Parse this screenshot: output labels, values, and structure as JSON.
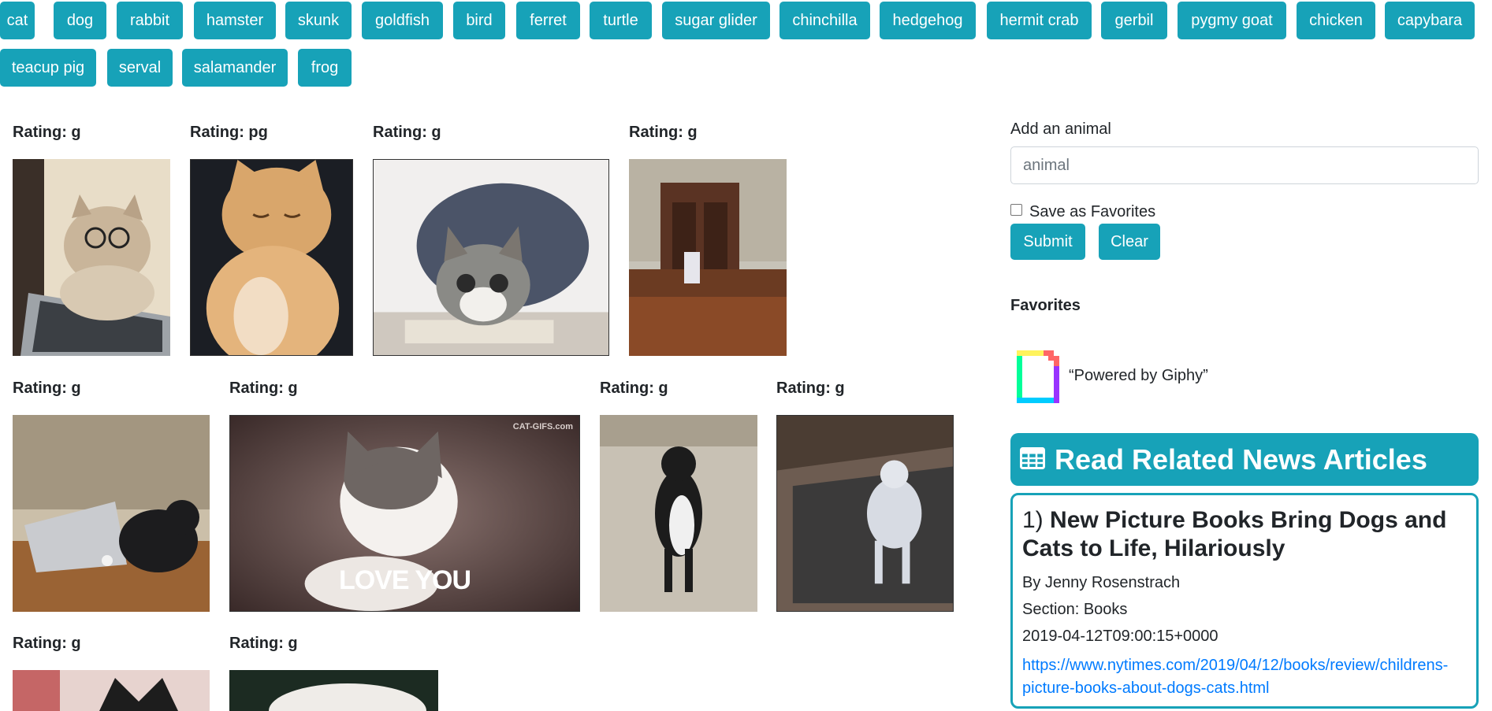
{
  "animal_buttons": [
    "cat",
    "dog",
    "rabbit",
    "hamster",
    "skunk",
    "goldfish",
    "bird",
    "ferret",
    "turtle",
    "sugar glider",
    "chinchilla",
    "hedgehog",
    "hermit crab",
    "gerbil",
    "pygmy goat",
    "chicken",
    "capybara",
    "teacup pig",
    "serval",
    "salamander",
    "frog"
  ],
  "gifs": [
    {
      "rating": "Rating: g"
    },
    {
      "rating": "Rating: pg"
    },
    {
      "rating": "Rating: g"
    },
    {
      "rating": "Rating: g"
    },
    {
      "rating": "Rating: g"
    },
    {
      "rating": "Rating: g",
      "caption": "LOVE YOU",
      "watermark": "CAT-GIFS.com"
    },
    {
      "rating": "Rating: g"
    },
    {
      "rating": "Rating: g"
    },
    {
      "rating": "Rating: g"
    },
    {
      "rating": "Rating: g"
    }
  ],
  "form": {
    "label": "Add an animal",
    "placeholder": "animal",
    "checkbox_label": "Save as Favorites",
    "submit_label": "Submit",
    "clear_label": "Clear"
  },
  "favorites": {
    "heading": "Favorites",
    "giphy_text": "“Powered by Giphy”"
  },
  "news": {
    "header": "Read Related News Articles",
    "icon": "table-icon",
    "article": {
      "number": "1)",
      "title": "New Picture Books Bring Dogs and Cats to Life, Hilariously",
      "byline": "By Jenny Rosenstrach",
      "section": "Section: Books",
      "date": "2019-04-12T09:00:15+0000",
      "url": "https://www.nytimes.com/2019/04/12/books/review/childrens-picture-books-about-dogs-cats.html"
    }
  },
  "colors": {
    "accent": "#17a2b8",
    "link": "#007bff",
    "text": "#212529"
  }
}
